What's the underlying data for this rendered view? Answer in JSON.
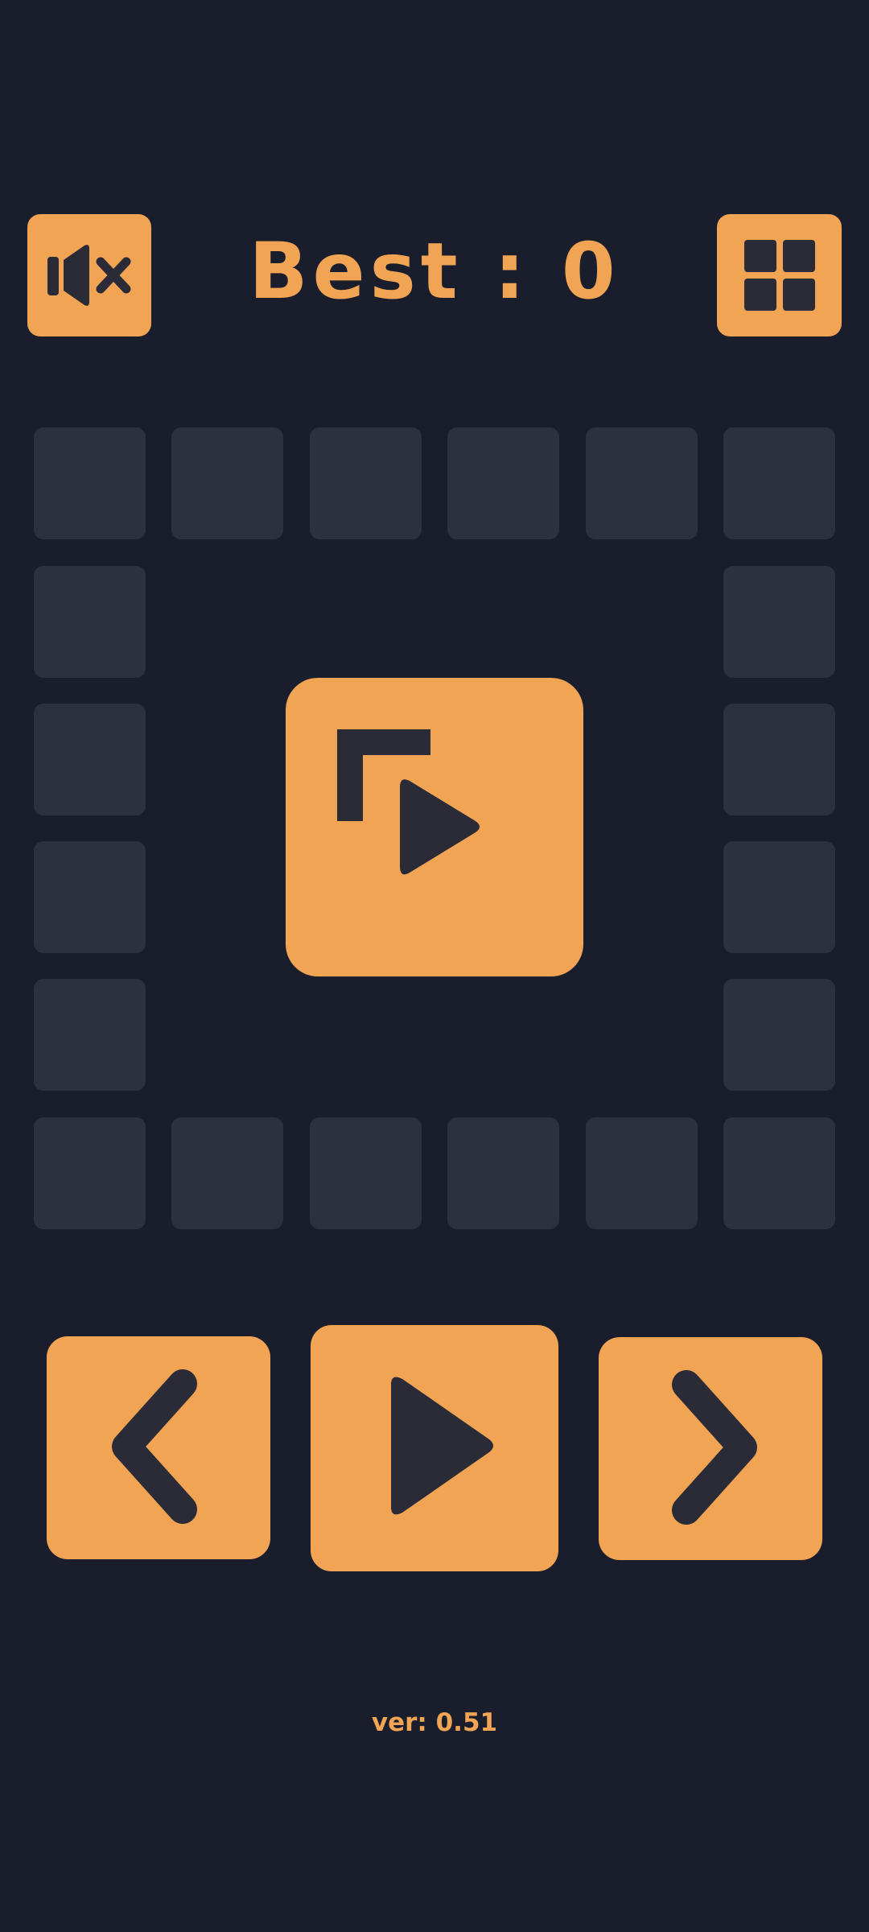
{
  "header": {
    "best_label": "Best : 0",
    "mute_icon": "speaker-muted-icon",
    "levels_icon": "grid-icon"
  },
  "board": {
    "start_icon": "corner-play-icon"
  },
  "controls": {
    "left_icon": "chevron-left-icon",
    "play_icon": "play-icon",
    "right_icon": "chevron-right-icon"
  },
  "footer": {
    "version": "ver: 0.51"
  },
  "colors": {
    "background": "#1a1e2c",
    "accent": "#f0a454",
    "cell": "#2c313f",
    "icon": "#2a2b36"
  }
}
